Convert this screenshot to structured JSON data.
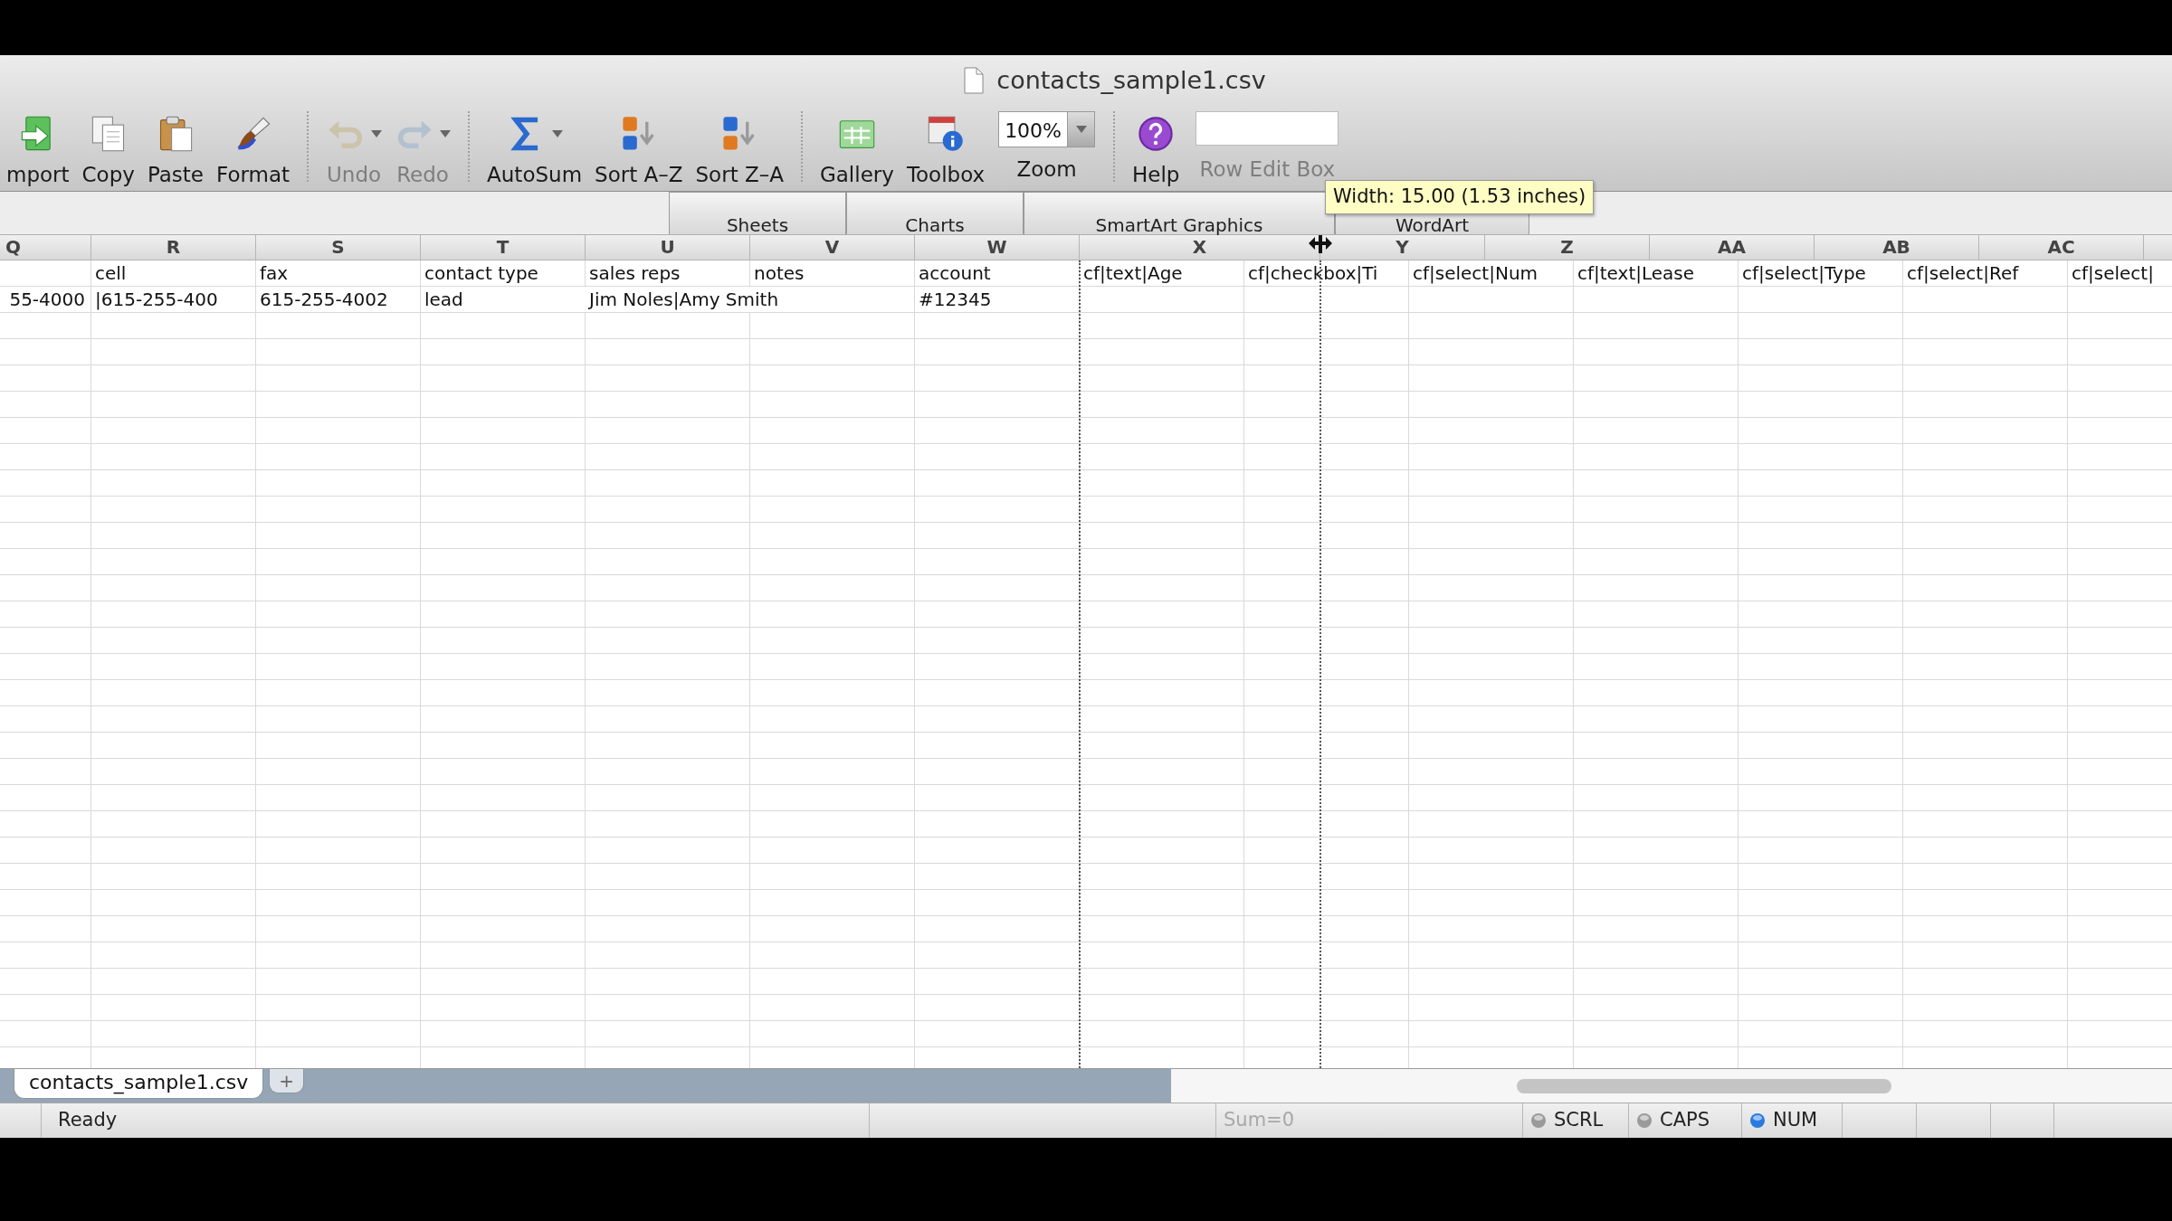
{
  "window": {
    "title": "contacts_sample1.csv"
  },
  "toolbar": {
    "groups": [
      [
        {
          "kind": "button",
          "label": "mport",
          "disabled": false
        },
        {
          "kind": "button",
          "label": "Copy",
          "disabled": false
        },
        {
          "kind": "button",
          "label": "Paste",
          "disabled": false
        },
        {
          "kind": "button",
          "label": "Format",
          "disabled": false
        }
      ],
      [
        {
          "kind": "split",
          "label": "Undo",
          "disabled": true
        },
        {
          "kind": "split",
          "label": "Redo",
          "disabled": true
        }
      ],
      [
        {
          "kind": "split",
          "label": "AutoSum",
          "disabled": false
        },
        {
          "kind": "button",
          "label": "Sort A–Z",
          "disabled": false
        },
        {
          "kind": "button",
          "label": "Sort Z–A",
          "disabled": false
        }
      ],
      [
        {
          "kind": "button",
          "label": "Gallery",
          "disabled": false
        },
        {
          "kind": "button",
          "label": "Toolbox",
          "disabled": false
        },
        {
          "kind": "combo",
          "label": "Zoom",
          "value": "100%",
          "disabled": false
        }
      ],
      [
        {
          "kind": "button",
          "label": "Help",
          "disabled": false
        },
        {
          "kind": "field",
          "label": "Row Edit Box",
          "disabled": true
        }
      ]
    ]
  },
  "ribbon_tabs": [
    {
      "label": "Sheets"
    },
    {
      "label": "Charts"
    },
    {
      "label": "SmartArt Graphics"
    },
    {
      "label": "WordArt"
    }
  ],
  "resize_tooltip": "Width: 15.00 (1.53 inches)",
  "columns": [
    {
      "letter": "Q",
      "resizing": false
    },
    {
      "letter": "R",
      "resizing": false
    },
    {
      "letter": "S",
      "resizing": false
    },
    {
      "letter": "T",
      "resizing": false
    },
    {
      "letter": "U",
      "resizing": false
    },
    {
      "letter": "V",
      "resizing": false
    },
    {
      "letter": "W",
      "resizing": false
    },
    {
      "letter": "X",
      "resizing": true
    },
    {
      "letter": "Y",
      "resizing": false
    },
    {
      "letter": "Z",
      "resizing": false
    },
    {
      "letter": "AA",
      "resizing": false
    },
    {
      "letter": "AB",
      "resizing": false
    },
    {
      "letter": "AC",
      "resizing": false
    }
  ],
  "rows": [
    [
      "",
      "cell",
      "fax",
      "contact type",
      "sales reps",
      "notes",
      "account",
      "cf|text|Age",
      "cf|checkbox|Ti",
      "cf|select|Num",
      "cf|text|Lease",
      "cf|select|Type",
      "cf|select|Ref",
      "cf|select|"
    ],
    [
      "55-4000",
      "|615-255-400",
      "615-255-4002",
      "lead",
      "Jim Noles|Amy Smith",
      "",
      "#12345",
      "",
      "",
      "",
      "",
      "",
      "",
      ""
    ]
  ],
  "sheet_tabs": [
    {
      "label": "contacts_sample1.csv",
      "selected": true
    }
  ],
  "add_sheet": "+",
  "status_bar": {
    "message": "Ready",
    "sum": "Sum=0",
    "indicators": [
      {
        "label": "SCRL",
        "on": false
      },
      {
        "label": "CAPS",
        "on": false
      },
      {
        "label": "NUM",
        "on": true
      }
    ]
  }
}
